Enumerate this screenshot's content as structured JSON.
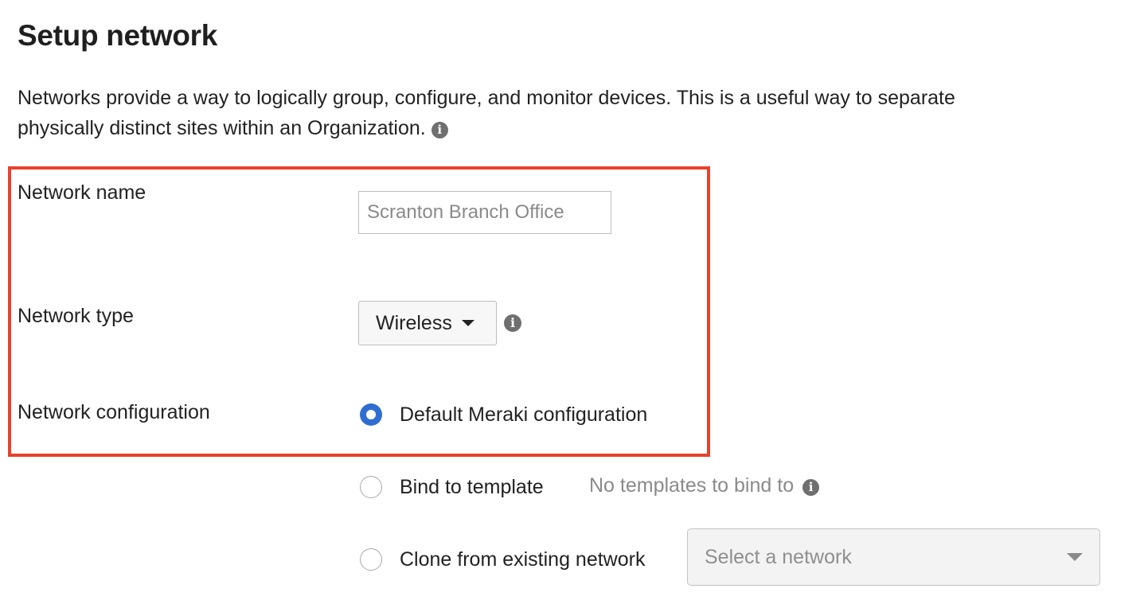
{
  "header": {
    "title": "Setup network",
    "description": "Networks provide a way to logically group, configure, and monitor devices. This is a useful way to separate physically distinct sites within an Organization."
  },
  "fields": {
    "network_name": {
      "label": "Network name",
      "placeholder": "Scranton Branch Office",
      "value": ""
    },
    "network_type": {
      "label": "Network type",
      "selected": "Wireless"
    },
    "network_configuration": {
      "label": "Network configuration",
      "options": [
        {
          "label": "Default Meraki configuration",
          "checked": true
        },
        {
          "label": "Bind to template",
          "checked": false,
          "note": "No templates to bind to"
        },
        {
          "label": "Clone from existing network",
          "checked": false,
          "select_placeholder": "Select a network"
        }
      ]
    }
  },
  "icons": {
    "info": "info-icon",
    "dropdown": "caret-down-icon"
  },
  "colors": {
    "highlight_border": "#e8412c",
    "radio_selected": "#2f6ed0",
    "muted_text": "#8a8a8a"
  }
}
